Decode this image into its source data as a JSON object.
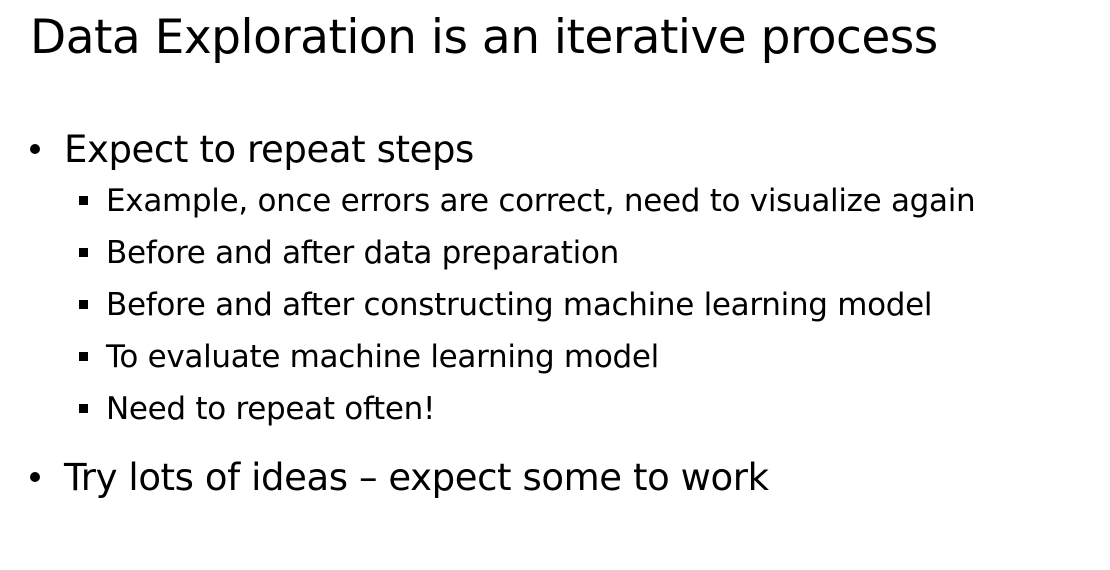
{
  "slide": {
    "title": "Data Exploration is an iterative process",
    "bullets": [
      {
        "text": "Expect to repeat steps",
        "subbullets": [
          "Example, once errors are correct, need to visualize again",
          "Before and after data preparation",
          "Before and after constructing machine learning model",
          "To evaluate machine learning model",
          "Need to repeat often!"
        ]
      },
      {
        "text": "Try lots of ideas – expect some to work",
        "subbullets": []
      }
    ]
  },
  "icons": {
    "level1": "bullet-dot-icon",
    "level2": "square-bullet-icon"
  }
}
